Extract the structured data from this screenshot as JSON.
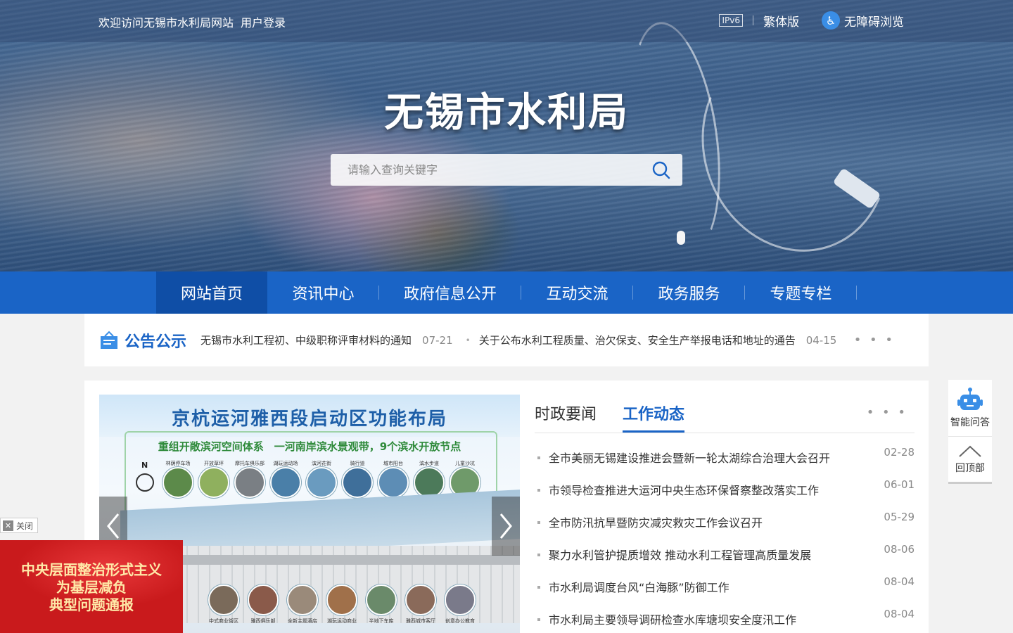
{
  "topbar": {
    "welcome": "欢迎访问无锡市水利局网站",
    "login": "用户登录",
    "ipv6": "IPv6",
    "traditional": "繁体版",
    "accessibility": "无障碍浏览"
  },
  "site_title": "无锡市水利局",
  "search": {
    "placeholder": "请输入查询关键字"
  },
  "nav": [
    {
      "label": "网站首页"
    },
    {
      "label": "资讯中心"
    },
    {
      "label": "政府信息公开"
    },
    {
      "label": "互动交流"
    },
    {
      "label": "政务服务"
    },
    {
      "label": "专题专栏"
    }
  ],
  "notice": {
    "title": "公告公示",
    "items": [
      {
        "title": "无锡市水利工程初、中级职称评审材料的通知",
        "date": "07-21"
      },
      {
        "title": "关于公布水利工程质量、治欠保支、安全生产举报电话和地址的通告",
        "date": "04-15"
      }
    ],
    "more": "• • •"
  },
  "slider": {
    "title": "京杭运河雅西段启动区功能布局",
    "subtitle": "重组开敞滨河空间体系　一河南岸滨水景观带，9个滨水开放节点",
    "nodes": [
      "林荫停车场",
      "开放草坪",
      "摩托车俱乐部",
      "湖玩运动场",
      "滨河花街",
      "骑行道",
      "城市阳台",
      "滨水步道",
      "儿童沙坑"
    ],
    "bottom_nodes": [
      "中式商业街区",
      "雅西俱乐部",
      "全新主题酒店",
      "湖玩运动商业",
      "半地下车库",
      "雅西城市客厅",
      "创意办公教育"
    ]
  },
  "news": {
    "tabs": [
      {
        "label": "时政要闻",
        "active": false
      },
      {
        "label": "工作动态",
        "active": true
      }
    ],
    "more": "• • •",
    "items": [
      {
        "title": "全市美丽无锡建设推进会暨新一轮太湖综合治理大会召开",
        "date": "02-28"
      },
      {
        "title": "市领导检查推进大运河中央生态环保督察整改落实工作",
        "date": "06-01"
      },
      {
        "title": "全市防汛抗旱暨防灾减灾救灾工作会议召开",
        "date": "05-29"
      },
      {
        "title": "聚力水利管护提质增效 推动水利工程管理高质量发展",
        "date": "08-06"
      },
      {
        "title": "市水利局调度台风“白海豚”防御工作",
        "date": "08-04"
      },
      {
        "title": "市水利局主要领导调研检查水库塘坝安全度汛工作",
        "date": "08-04"
      }
    ]
  },
  "float_right": {
    "ai": "智能问答",
    "top": "回顶部"
  },
  "float_left": {
    "close": "关闭",
    "promo_lines": [
      "中央层面整治形式主义",
      "为基层减负",
      "典型问题通报"
    ]
  },
  "colors": {
    "brand_blue": "#1a64c6",
    "nav_active": "#0f4ea6",
    "promo_red": "#c81b1d"
  }
}
